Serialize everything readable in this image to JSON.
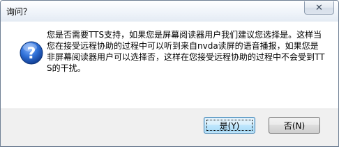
{
  "window": {
    "title": "询问？",
    "close_glyph": "✕"
  },
  "message": {
    "text": "您是否需要TTS支持，如果您是屏幕阅读器用户我们建议您选择是。这样当您在接受远程协助的过程中可以听到来自nvda读屏的语音播报，如果您是非屏幕阅读器用户可以选择否，这样在您接受远程协助的过程中不会受到TTS的干扰。",
    "icon": "question-icon"
  },
  "buttons": {
    "yes_label": "是(Y)",
    "no_label": "否(N)"
  },
  "colors": {
    "icon_blue": "#1f5fbf",
    "default_button_border": "#3c7fb1"
  }
}
